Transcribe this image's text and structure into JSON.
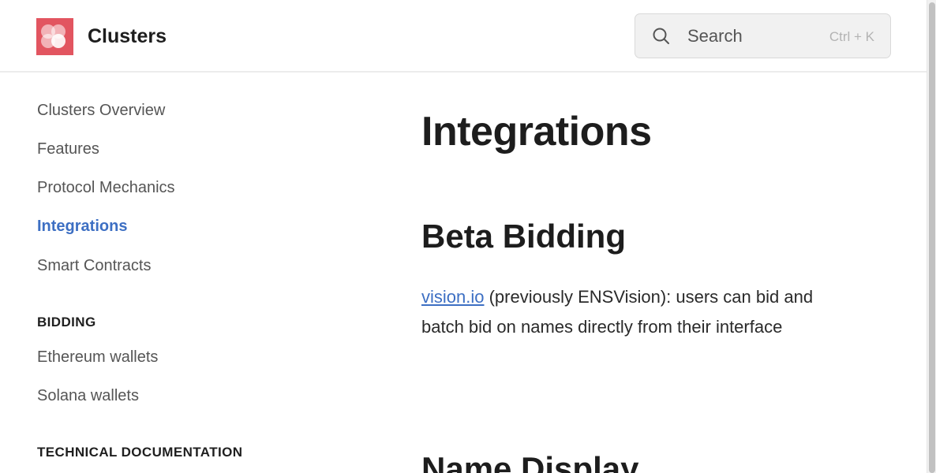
{
  "header": {
    "brand": "Clusters",
    "search": {
      "placeholder": "Search",
      "shortcut": "Ctrl + K"
    }
  },
  "sidebar": {
    "items": [
      {
        "label": "Clusters Overview",
        "active": false
      },
      {
        "label": "Features",
        "active": false
      },
      {
        "label": "Protocol Mechanics",
        "active": false
      },
      {
        "label": "Integrations",
        "active": true
      },
      {
        "label": "Smart Contracts",
        "active": false
      }
    ],
    "sections": [
      {
        "title": "BIDDING",
        "items": [
          {
            "label": "Ethereum wallets"
          },
          {
            "label": "Solana wallets"
          }
        ]
      },
      {
        "title": "TECHNICAL DOCUMENTATION",
        "items": []
      }
    ]
  },
  "content": {
    "title": "Integrations",
    "sections": [
      {
        "heading": "Beta Bidding",
        "link_text": "vision.io",
        "text": " (previously ENSVision): users can bid and batch bid on names directly from their interface"
      },
      {
        "heading": "Name Display"
      }
    ]
  },
  "colors": {
    "accent": "#3d6fc3",
    "logo": "#e25560"
  },
  "icons": {
    "logo": "clusters-logo-icon",
    "search": "search-icon"
  }
}
